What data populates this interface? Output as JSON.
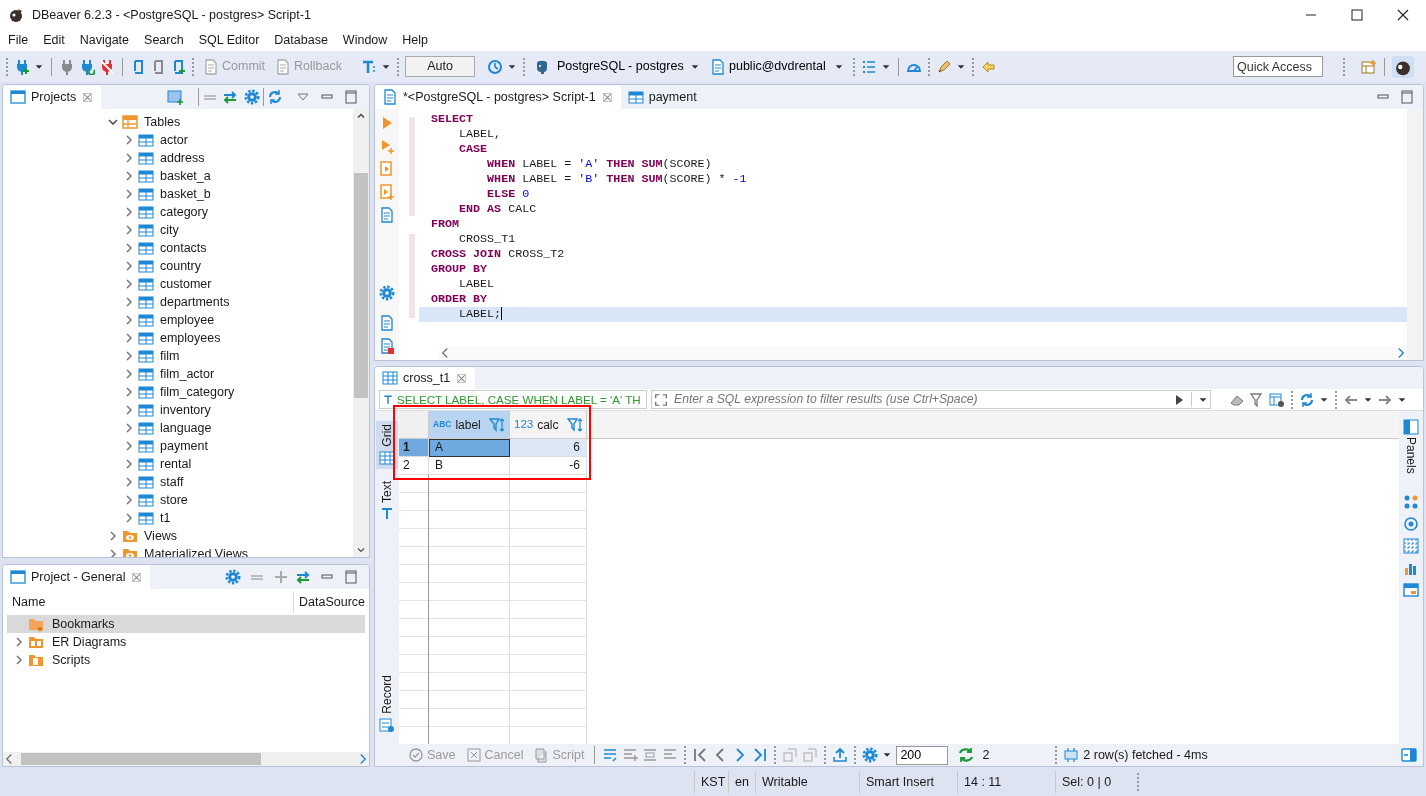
{
  "window": {
    "title": "DBeaver 6.2.3 - <PostgreSQL - postgres> Script-1"
  },
  "menu": [
    "File",
    "Edit",
    "Navigate",
    "Search",
    "SQL Editor",
    "Database",
    "Window",
    "Help"
  ],
  "toolbar": {
    "commit": {
      "label": "Commit",
      "disabled": true
    },
    "rollback": {
      "label": "Rollback",
      "disabled": true
    },
    "commit_mode": "Auto",
    "connection": "PostgreSQL - postgres",
    "schema": "public@dvdrental",
    "quick_access": {
      "placeholder": "Quick Access"
    }
  },
  "projects": {
    "title": "Projects",
    "tree": [
      {
        "label": "Tables",
        "kind": "tables",
        "expanded": true,
        "children": [
          {
            "label": "actor",
            "expanded": false
          },
          {
            "label": "address",
            "expanded": false
          },
          {
            "label": "basket_a",
            "expanded": false
          },
          {
            "label": "basket_b",
            "expanded": false
          },
          {
            "label": "category",
            "expanded": false
          },
          {
            "label": "city",
            "expanded": false
          },
          {
            "label": "contacts",
            "expanded": false
          },
          {
            "label": "country",
            "expanded": false
          },
          {
            "label": "customer",
            "expanded": false
          },
          {
            "label": "departments",
            "expanded": false
          },
          {
            "label": "employee",
            "expanded": false
          },
          {
            "label": "employees",
            "expanded": false
          },
          {
            "label": "film",
            "expanded": false
          },
          {
            "label": "film_actor",
            "expanded": false
          },
          {
            "label": "film_category",
            "expanded": false
          },
          {
            "label": "inventory",
            "expanded": false
          },
          {
            "label": "language",
            "expanded": false
          },
          {
            "label": "payment",
            "expanded": false
          },
          {
            "label": "rental",
            "expanded": false
          },
          {
            "label": "staff",
            "expanded": false
          },
          {
            "label": "store",
            "expanded": false
          },
          {
            "label": "t1",
            "expanded": false
          }
        ]
      },
      {
        "label": "Views",
        "kind": "views",
        "expanded": false
      },
      {
        "label": "Materialized Views",
        "kind": "views",
        "expanded": false
      }
    ]
  },
  "project_general": {
    "title": "Project - General",
    "columns": [
      "Name",
      "DataSource"
    ],
    "items": [
      {
        "label": "Bookmarks",
        "kind": "bookmarks",
        "selected": true,
        "expandable": false
      },
      {
        "label": "ER Diagrams",
        "kind": "diagrams",
        "selected": false,
        "expandable": true
      },
      {
        "label": "Scripts",
        "kind": "scripts",
        "selected": false,
        "expandable": true
      }
    ]
  },
  "editor": {
    "tabs": [
      {
        "label": "*<PostgreSQL - postgres> Script-1",
        "kind": "script",
        "selected": true
      },
      {
        "label": "payment",
        "kind": "table",
        "selected": false
      }
    ],
    "lines": [
      {
        "current": false,
        "tokens": [
          {
            "kind": "keyword",
            "text": "SELECT"
          }
        ]
      },
      {
        "current": false,
        "tokens": [
          {
            "kind": "text",
            "text": "    LABEL,"
          }
        ]
      },
      {
        "current": false,
        "tokens": [
          {
            "kind": "keyword",
            "text": "    CASE"
          }
        ]
      },
      {
        "current": false,
        "tokens": [
          {
            "kind": "keyword",
            "text": "        WHEN"
          },
          {
            "kind": "text",
            "text": " LABEL = "
          },
          {
            "kind": "string",
            "text": "'A'"
          },
          {
            "kind": "keyword",
            "text": " THEN SUM"
          },
          {
            "kind": "text",
            "text": "(SCORE)"
          }
        ]
      },
      {
        "current": false,
        "tokens": [
          {
            "kind": "keyword",
            "text": "        WHEN"
          },
          {
            "kind": "text",
            "text": " LABEL = "
          },
          {
            "kind": "string",
            "text": "'B'"
          },
          {
            "kind": "keyword",
            "text": " THEN SUM"
          },
          {
            "kind": "text",
            "text": "(SCORE) * "
          },
          {
            "kind": "number",
            "text": "-1"
          }
        ]
      },
      {
        "current": false,
        "tokens": [
          {
            "kind": "keyword",
            "text": "        ELSE"
          },
          {
            "kind": "number",
            "text": " 0"
          }
        ]
      },
      {
        "current": false,
        "tokens": [
          {
            "kind": "keyword",
            "text": "    END AS"
          },
          {
            "kind": "text",
            "text": " CALC"
          }
        ]
      },
      {
        "current": false,
        "tokens": [
          {
            "kind": "keyword",
            "text": "FROM"
          }
        ]
      },
      {
        "current": false,
        "tokens": [
          {
            "kind": "text",
            "text": "    CROSS_T1"
          }
        ]
      },
      {
        "current": false,
        "tokens": [
          {
            "kind": "keyword",
            "text": "CROSS JOIN"
          },
          {
            "kind": "text",
            "text": " CROSS_T2"
          }
        ]
      },
      {
        "current": false,
        "tokens": [
          {
            "kind": "keyword",
            "text": "GROUP BY"
          }
        ]
      },
      {
        "current": false,
        "tokens": [
          {
            "kind": "text",
            "text": "    LABEL"
          }
        ]
      },
      {
        "current": false,
        "tokens": [
          {
            "kind": "keyword",
            "text": "ORDER BY"
          }
        ]
      },
      {
        "current": true,
        "tokens": [
          {
            "kind": "text",
            "text": "    LABEL;"
          }
        ]
      }
    ]
  },
  "results": {
    "tab": "cross_t1",
    "query": "SELECT LABEL, CASE WHEN LABEL = 'A' TH",
    "filter": {
      "placeholder": "Enter a SQL expression to filter results (use Ctrl+Space)"
    },
    "view_tabs": [
      {
        "label": "Grid",
        "selected": true
      },
      {
        "label": "Text",
        "selected": false
      },
      {
        "label": "Record",
        "selected": false
      }
    ],
    "columns": [
      {
        "type": "ABC",
        "name": "label",
        "kind": "string"
      },
      {
        "type": "123",
        "name": "calc",
        "kind": "number"
      }
    ],
    "rows": [
      {
        "number": "1",
        "selected": true,
        "cells": [
          {
            "text": "A",
            "focused": true
          },
          {
            "text": "6",
            "focused": false
          }
        ]
      },
      {
        "number": "2",
        "selected": false,
        "cells": [
          {
            "text": "B",
            "focused": false
          },
          {
            "text": "-6",
            "focused": false
          }
        ]
      }
    ],
    "highlight": true,
    "panels": "Panels",
    "actions": [
      {
        "label": "Save",
        "disabled": true
      },
      {
        "label": "Cancel",
        "disabled": true
      },
      {
        "label": "Script",
        "disabled": true
      }
    ],
    "fetch_size": "200",
    "row_count": "2",
    "status": "2 row(s) fetched - 4ms"
  },
  "status_bar": [
    "KST",
    "en",
    "Writable",
    "Smart Insert",
    "14 : 11",
    "Sel: 0 | 0"
  ]
}
